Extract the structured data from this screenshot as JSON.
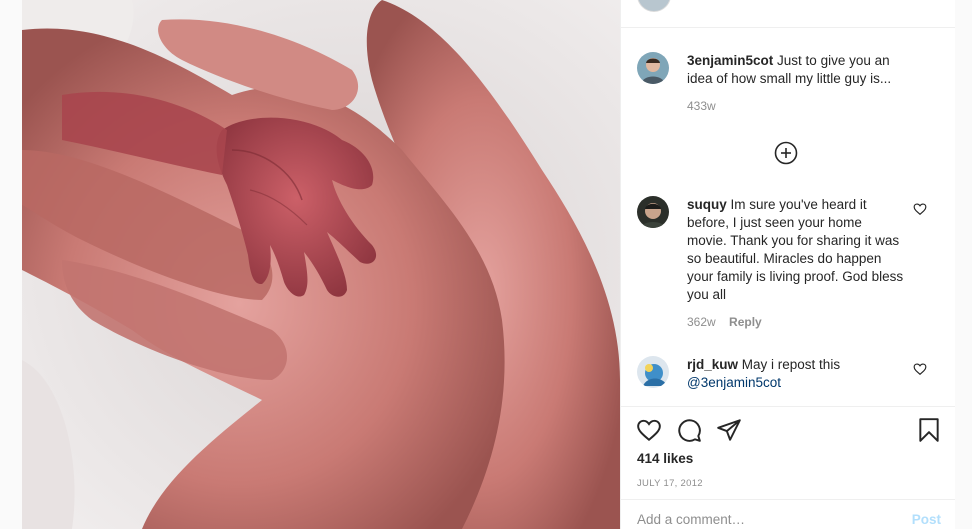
{
  "post": {
    "image_alt": "Tiny newborn hand resting in an adult palm",
    "caption": {
      "username": "3enjamin5cot",
      "text": "Just to give you an idea of how small my little guy is...",
      "time": "433w"
    },
    "load_more_icon": "plus-circle-icon",
    "comments": [
      {
        "username": "suquy",
        "text": "Im sure you've heard it before, I just seen your home movie. Thank you for sharing it was so beautiful. Miracles do happen your family is living proof. God bless you all",
        "time": "362w",
        "reply_label": "Reply"
      },
      {
        "username": "rjd_kuw",
        "text": "May i repost this",
        "mention": "@3enjamin5cot"
      }
    ],
    "actions": {
      "like_icon": "heart-icon",
      "comment_icon": "comment-icon",
      "share_icon": "paper-plane-icon",
      "save_icon": "bookmark-icon"
    },
    "likes": "414 likes",
    "date": "JULY 17, 2012",
    "add_comment": {
      "placeholder": "Add a comment…",
      "post_label": "Post"
    }
  },
  "colors": {
    "text": "#262626",
    "muted": "#8e8e8e",
    "link": "#00376b",
    "post_disabled": "#b2dffc",
    "border": "#efefef"
  }
}
